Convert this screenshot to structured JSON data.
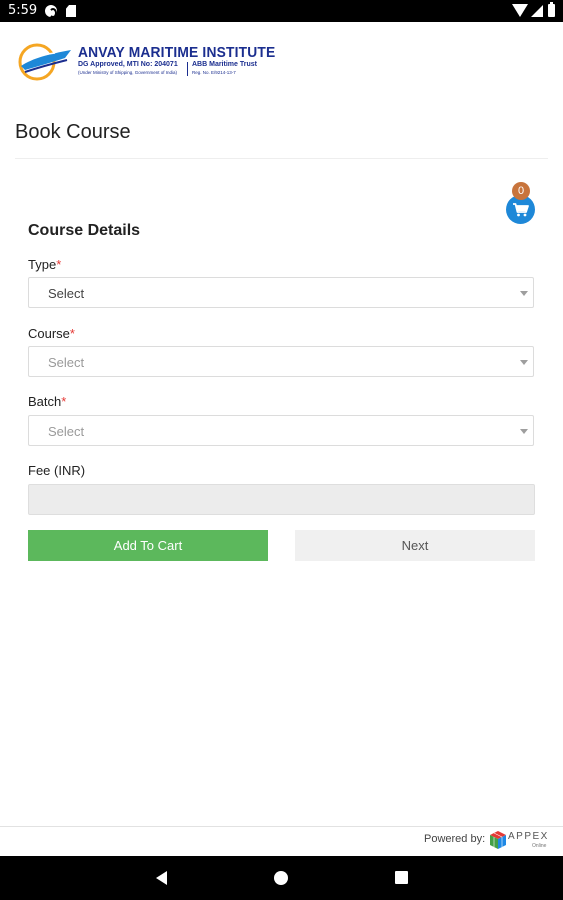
{
  "status_bar": {
    "time": "5:59",
    "icons": [
      "google-icon",
      "sd-card-icon",
      "wifi-icon",
      "signal-icon",
      "battery-icon"
    ]
  },
  "logo": {
    "title": "ANVAY MARITIME INSTITUTE",
    "subtitle_left": "DG Approved, MTI No: 204071",
    "subtitle_left_small": "(Under Ministry of Shipping, Government of India)",
    "subtitle_right": "ABB Maritime Trust",
    "subtitle_right_small": "Reg. No. E/9214-13-7"
  },
  "page": {
    "title": "Book Course"
  },
  "cart": {
    "count": "0",
    "icon": "cart-icon",
    "color": "#1e88d8",
    "badge_color": "#c8743c"
  },
  "form": {
    "section_title": "Course Details",
    "required_marker": "*",
    "type": {
      "label": "Type",
      "value": "Select"
    },
    "course": {
      "label": "Course",
      "value": "Select"
    },
    "batch": {
      "label": "Batch",
      "value": "Select"
    },
    "fee": {
      "label": "Fee (INR)",
      "value": ""
    },
    "add_to_cart_label": "Add To Cart",
    "next_label": "Next",
    "add_to_cart_color": "#5cb85c"
  },
  "footer": {
    "powered_by": "Powered by:",
    "brand": "APPEX",
    "brand_sub": "Online"
  },
  "nav_bar": {
    "icons": [
      "back-icon",
      "home-icon",
      "recents-icon"
    ]
  }
}
